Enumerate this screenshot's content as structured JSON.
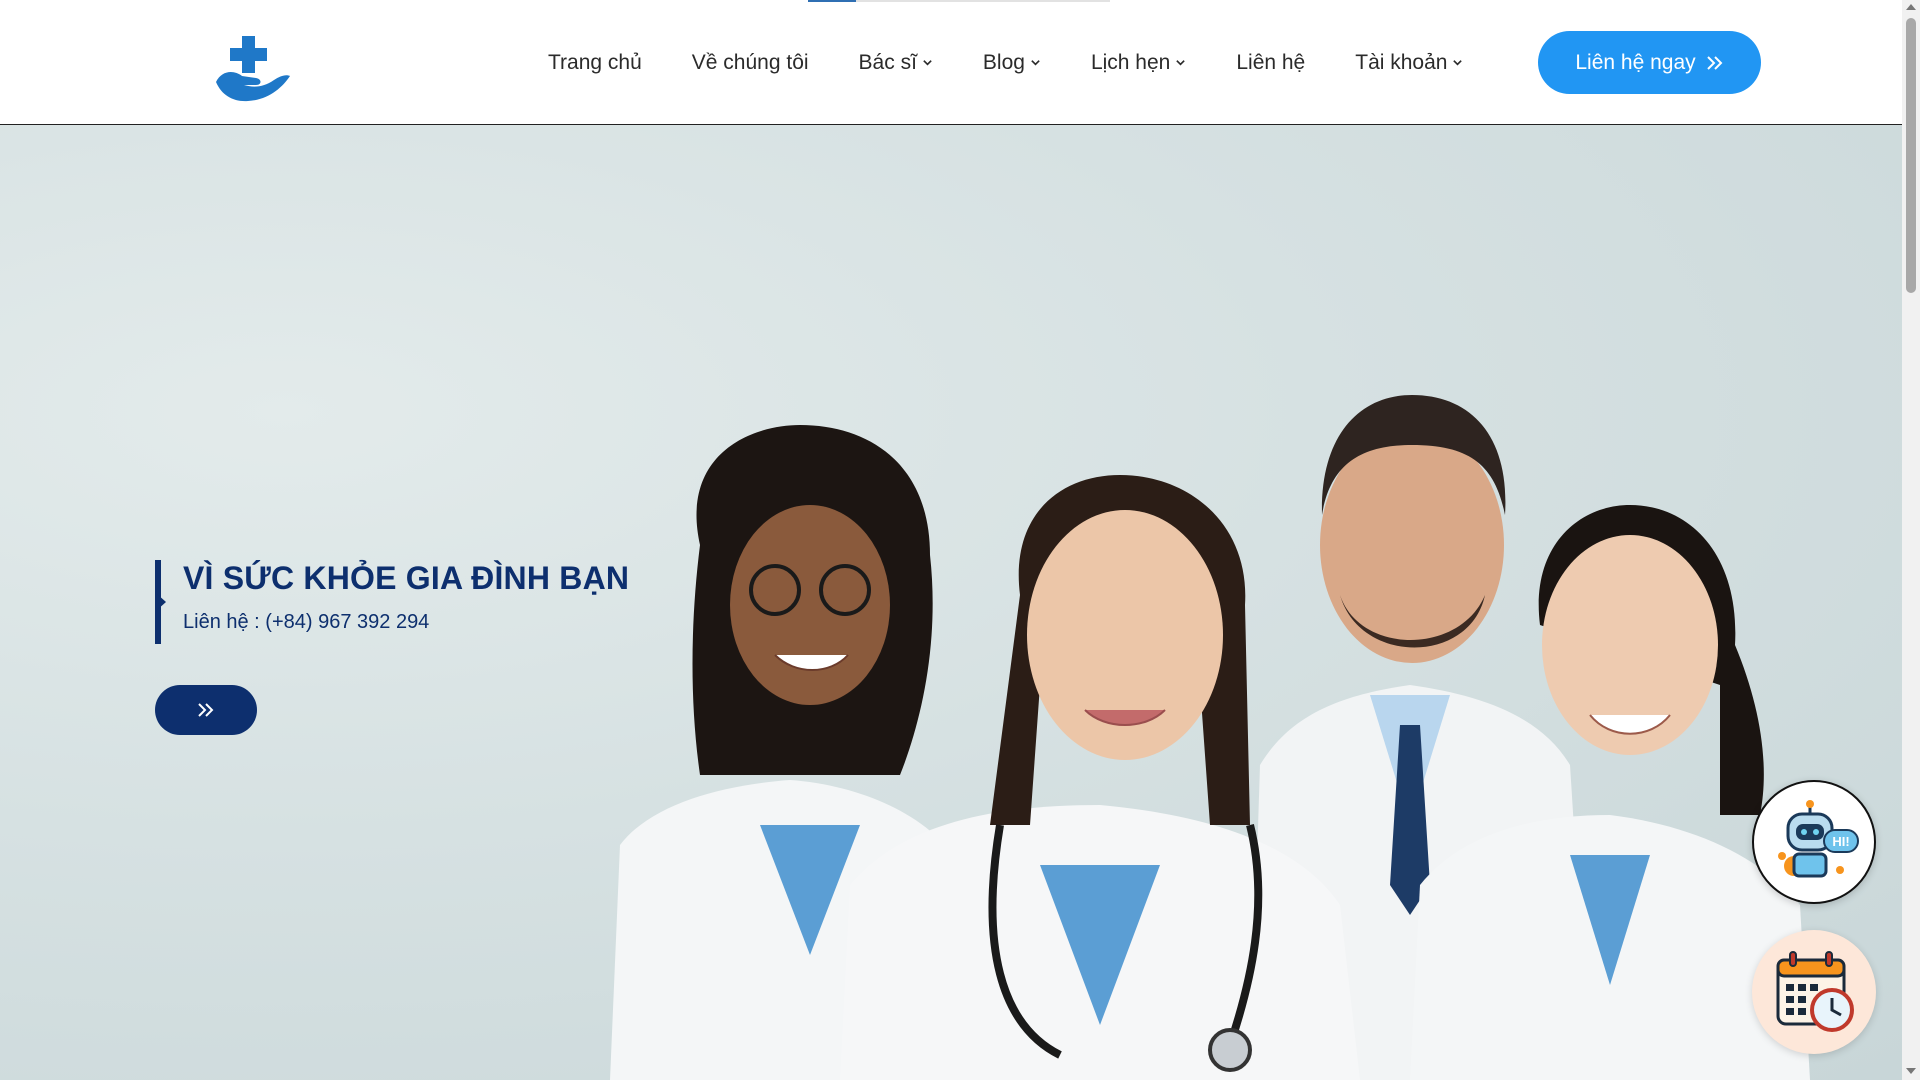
{
  "header": {
    "scroll_progress": 0.16,
    "nav": [
      {
        "label": "Trang chủ",
        "dropdown": false
      },
      {
        "label": "Về chúng tôi",
        "dropdown": false
      },
      {
        "label": "Bác sĩ",
        "dropdown": true
      },
      {
        "label": "Blog",
        "dropdown": true
      },
      {
        "label": "Lịch hẹn",
        "dropdown": true
      },
      {
        "label": "Liên hệ",
        "dropdown": false
      },
      {
        "label": "Tài khoản",
        "dropdown": true
      }
    ],
    "cta_label": "Liên hệ ngay"
  },
  "hero": {
    "title": "VÌ SỨC KHỎE GIA ĐÌNH BẠN",
    "phone_line": "Liên hệ : (+84) 967 392 294"
  },
  "floating": {
    "chatbot_badge": "HI!"
  },
  "icons": [
    "medical-hand-logo-icon",
    "chevron-down-icon",
    "double-chevron-right-icon",
    "chatbot-icon",
    "calendar-clock-icon"
  ],
  "colors": {
    "primary_blue": "#2196f3",
    "navy": "#0d2f6e",
    "logo_blue": "#1f78c8",
    "hero_bg": "#d6e1e2"
  }
}
